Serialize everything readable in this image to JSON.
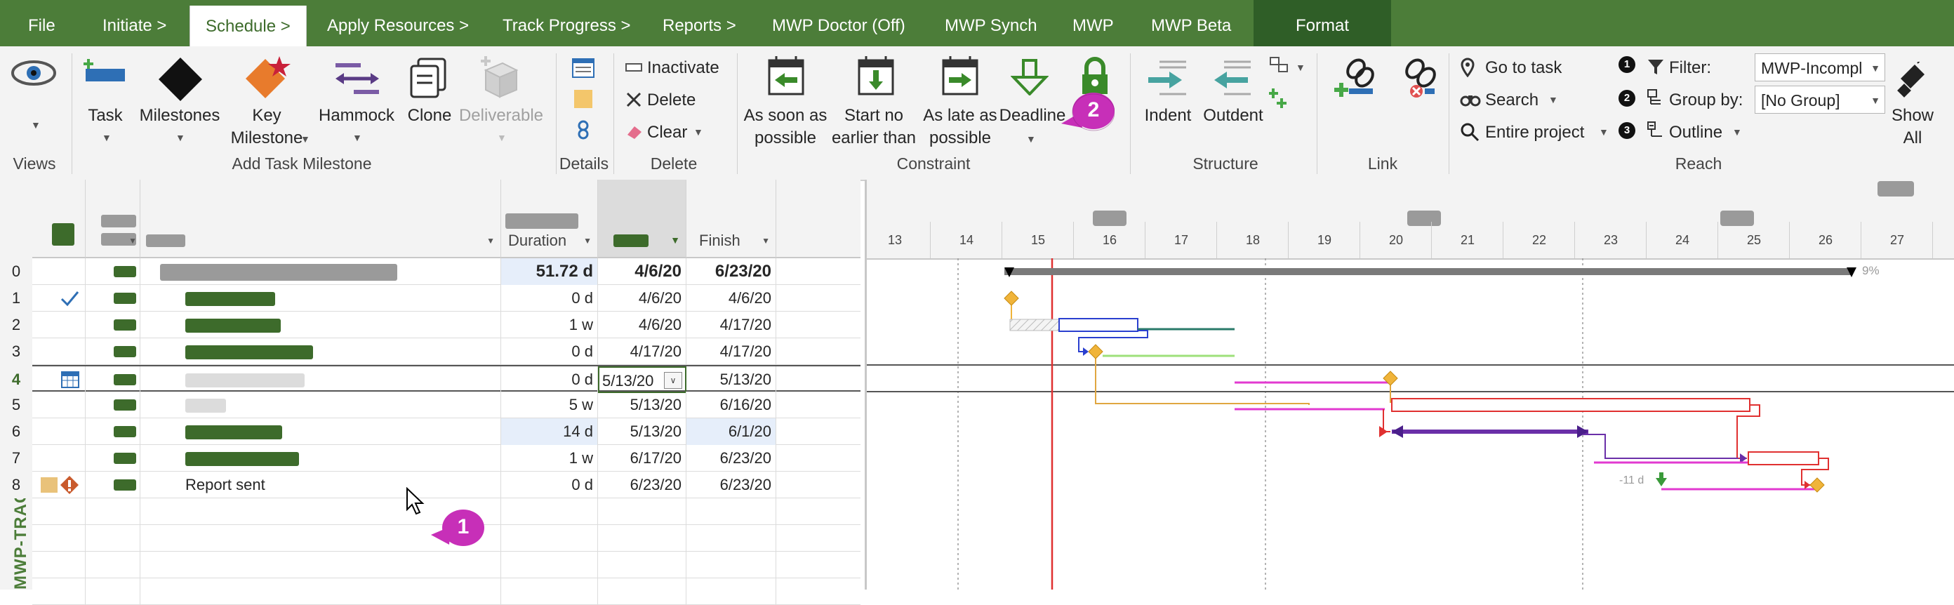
{
  "menu": {
    "file": "File",
    "initiate": "Initiate >",
    "schedule": "Schedule >",
    "apply_resources": "Apply Resources >",
    "track_progress": "Track Progress >",
    "reports": "Reports >",
    "mwp_doctor": "MWP Doctor (Off)",
    "mwp_synch": "MWP Synch",
    "mwp": "MWP",
    "mwp_beta": "MWP Beta",
    "format": "Format"
  },
  "ribbon": {
    "views_group": "Views",
    "task": "Task",
    "milestones": "Milestones",
    "key_milestone_1": "Key",
    "key_milestone_2": "Milestone",
    "hammock": "Hammock",
    "clone": "Clone",
    "deliverable": "Deliverable",
    "add_task_group": "Add Task  Milestone",
    "details_group": "Details",
    "inactivate": "Inactivate",
    "delete": "Delete",
    "clear": "Clear",
    "delete_group": "Delete",
    "asap_1": "As soon as",
    "asap_2": "possible",
    "snet_1": "Start no",
    "snet_2": "earlier than",
    "alap_1": "As late as",
    "alap_2": "possible",
    "deadline": "Deadline",
    "constraint_group": "Constraint",
    "indent": "Indent",
    "outdent": "Outdent",
    "structure_group": "Structure",
    "link_group": "Link",
    "go_to_task": "Go to task",
    "search": "Search",
    "entire_project": "Entire project",
    "filter_label": "Filter:",
    "filter_value": "MWP-Incompl",
    "group_label": "Group by:",
    "group_value": "[No Group]",
    "outline": "Outline",
    "reach_group": "Reach",
    "show_all_1": "Show",
    "show_all_2": "All",
    "num1": "1",
    "num2": "2",
    "num3": "3"
  },
  "view_tab": "MWP-TRACKING GANTT",
  "table": {
    "headers": {
      "duration": "Duration",
      "finish": "Finish"
    },
    "rows": [
      {
        "id": "0",
        "name": "",
        "duration": "51.72 d",
        "start": "4/6/20",
        "finish": "6/23/20"
      },
      {
        "id": "1",
        "name": "",
        "duration": "0 d",
        "start": "4/6/20",
        "finish": "4/6/20"
      },
      {
        "id": "2",
        "name": "",
        "duration": "1 w",
        "start": "4/6/20",
        "finish": "4/17/20"
      },
      {
        "id": "3",
        "name": "",
        "duration": "0 d",
        "start": "4/17/20",
        "finish": "4/17/20"
      },
      {
        "id": "4",
        "name": "",
        "duration": "0 d",
        "start": "5/13/20",
        "finish": "5/13/20"
      },
      {
        "id": "5",
        "name": "",
        "duration": "5 w",
        "start": "5/13/20",
        "finish": "6/16/20"
      },
      {
        "id": "6",
        "name": "",
        "duration": "14 d",
        "start": "5/13/20",
        "finish": "6/1/20"
      },
      {
        "id": "7",
        "name": "",
        "duration": "1 w",
        "start": "6/17/20",
        "finish": "6/23/20"
      },
      {
        "id": "8",
        "name": "Report sent",
        "duration": "0 d",
        "start": "6/23/20",
        "finish": "6/23/20"
      }
    ]
  },
  "gantt": {
    "days": [
      "13",
      "14",
      "15",
      "16",
      "17",
      "18",
      "19",
      "20",
      "21",
      "22",
      "23",
      "24",
      "25",
      "26",
      "27"
    ],
    "summary_pct": "9%",
    "slack_label": "-11 d"
  },
  "callouts": {
    "one": "1",
    "two": "2"
  },
  "colors": {
    "menu_green": "#4c7d39",
    "dark_green": "#3d6b2b",
    "callout_magenta": "#c72fb8"
  }
}
